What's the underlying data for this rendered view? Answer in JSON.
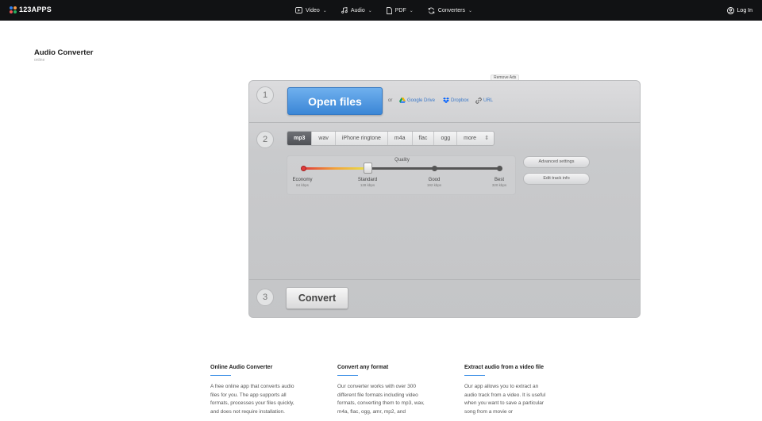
{
  "header": {
    "logo": "123APPS",
    "logo_colors": [
      "#2f80ed",
      "#f2994a",
      "#eb5757",
      "#27ae60"
    ],
    "nav": [
      {
        "label": "Video",
        "icon": "video-icon"
      },
      {
        "label": "Audio",
        "icon": "music-note-icon"
      },
      {
        "label": "PDF",
        "icon": "document-icon"
      },
      {
        "label": "Converters",
        "icon": "refresh-icon"
      }
    ],
    "login": "Log In"
  },
  "page": {
    "title": "Audio Converter",
    "subtitle": "online",
    "remove_ads": "Remove Ads"
  },
  "step1": {
    "number": "1",
    "open_files": "Open files",
    "or": "or",
    "sources": [
      {
        "label": "Google Drive",
        "icon": "google-drive-icon"
      },
      {
        "label": "Dropbox",
        "icon": "dropbox-icon"
      },
      {
        "label": "URL",
        "icon": "link-icon"
      }
    ]
  },
  "step2": {
    "number": "2",
    "formats": [
      "mp3",
      "wav",
      "iPhone ringtone",
      "m4a",
      "flac",
      "ogg",
      "more"
    ],
    "selected_format": "mp3",
    "quality": {
      "title": "Quality",
      "selected_index": 1,
      "levels": [
        {
          "name": "Economy",
          "kbps": "64 kbps"
        },
        {
          "name": "Standard",
          "kbps": "128 kbps"
        },
        {
          "name": "Good",
          "kbps": "192 kbps"
        },
        {
          "name": "Best",
          "kbps": "320 kbps"
        }
      ]
    },
    "advanced_settings": "Advanced settings",
    "edit_track_info": "Edit track info"
  },
  "step3": {
    "number": "3",
    "convert": "Convert"
  },
  "info": [
    {
      "title": "Online Audio Converter",
      "text": "A free online app that converts audio files for you. The app supports all formats, processes your files quickly, and does not require installation."
    },
    {
      "title": "Convert any format",
      "text": "Our converter works with over 300 different file formats including video formats, converting them to mp3, wav, m4a, flac, ogg, amr, mp2, and"
    },
    {
      "title": "Extract audio from a video file",
      "text": "Our app allows you to extract an audio track from a video. It is useful when you want to save a particular song from a movie or"
    }
  ]
}
